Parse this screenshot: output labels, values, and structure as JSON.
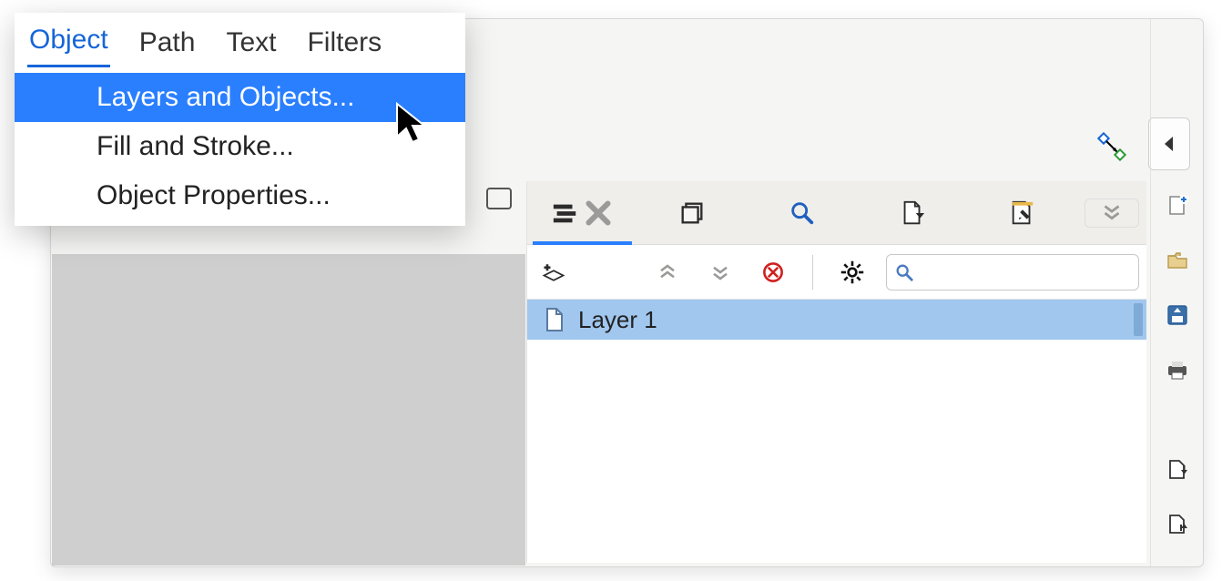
{
  "menubar": {
    "items": [
      {
        "label": "Object",
        "active": true
      },
      {
        "label": "Path",
        "active": false
      },
      {
        "label": "Text",
        "active": false
      },
      {
        "label": "Filters",
        "active": false
      }
    ]
  },
  "menu_dropdown": {
    "items": [
      {
        "label": "Layers and Objects...",
        "highlighted": true
      },
      {
        "label": "Fill and Stroke...",
        "highlighted": false
      },
      {
        "label": "Object Properties...",
        "highlighted": false
      }
    ]
  },
  "panel": {
    "tabs": [
      {
        "name": "layers",
        "icon": "layers-icon",
        "active": true
      },
      {
        "name": "objects",
        "icon": "stack-icon",
        "active": false
      },
      {
        "name": "find",
        "icon": "magnify-icon",
        "active": false
      },
      {
        "name": "document",
        "icon": "page-arrow-icon",
        "active": false
      },
      {
        "name": "edit",
        "icon": "edit-page-icon",
        "active": false
      },
      {
        "name": "more",
        "icon": "chevrons-down-icon",
        "active": false
      }
    ],
    "tools": {
      "add_layer": "add-layer",
      "move_up": "move-up",
      "move_down": "move-down",
      "delete": "delete",
      "settings": "settings",
      "search_placeholder": ""
    },
    "layers": [
      {
        "label": "Layer 1"
      }
    ]
  },
  "right_toolbar": {
    "items": [
      {
        "name": "new-doc-icon"
      },
      {
        "name": "open-folder-icon"
      },
      {
        "name": "save-icon"
      },
      {
        "name": "print-icon"
      },
      {
        "name": "import-icon"
      },
      {
        "name": "export-icon"
      }
    ]
  }
}
